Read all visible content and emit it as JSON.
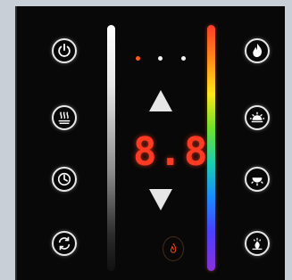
{
  "panel": {
    "display_value": "8.8",
    "indicator_dots": [
      {
        "color": "#ff5a1a"
      },
      {
        "color": "#f2f2f2"
      },
      {
        "color": "#f2f2f2"
      },
      {
        "color": "#f2f2f2"
      }
    ],
    "left_buttons": [
      {
        "icon": "power-icon"
      },
      {
        "icon": "heat-waves-icon"
      },
      {
        "icon": "clock-icon"
      },
      {
        "icon": "cycle-icon"
      }
    ],
    "right_buttons": [
      {
        "icon": "flame-icon"
      },
      {
        "icon": "bright-light-icon"
      },
      {
        "icon": "dim-light-icon"
      },
      {
        "icon": "ember-icon"
      }
    ],
    "center_controls": {
      "up_icon": "up-arrow-icon",
      "down_icon": "down-arrow-icon",
      "flame_icon": "small-flame-icon"
    },
    "colors": {
      "panel_background": "#080808",
      "display_red": "#ff3a22",
      "accent_orange": "#ff5a1a"
    }
  }
}
